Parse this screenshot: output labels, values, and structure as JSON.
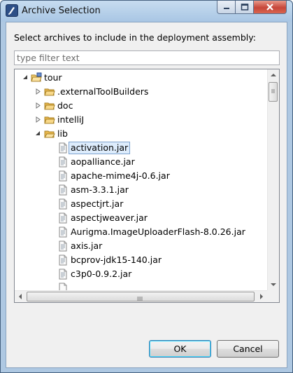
{
  "window": {
    "title": "Archive Selection"
  },
  "dialog": {
    "instruction": "Select archives to include in the deployment assembly:",
    "filter_placeholder": "type filter text",
    "filter_value": ""
  },
  "tree": {
    "items": [
      {
        "label": "tour",
        "type": "project",
        "expanded": true,
        "level": 0
      },
      {
        "label": ".externalToolBuilders",
        "type": "folder",
        "expanded": false,
        "level": 1
      },
      {
        "label": "doc",
        "type": "folder",
        "expanded": false,
        "level": 1
      },
      {
        "label": "intelliJ",
        "type": "folder",
        "expanded": false,
        "level": 1
      },
      {
        "label": "lib",
        "type": "folder",
        "expanded": true,
        "level": 1
      },
      {
        "label": "activation.jar",
        "type": "jar",
        "level": 2,
        "selected": true
      },
      {
        "label": "aopalliance.jar",
        "type": "jar",
        "level": 2
      },
      {
        "label": "apache-mime4j-0.6.jar",
        "type": "jar",
        "level": 2
      },
      {
        "label": "asm-3.3.1.jar",
        "type": "jar",
        "level": 2
      },
      {
        "label": "aspectjrt.jar",
        "type": "jar",
        "level": 2
      },
      {
        "label": "aspectjweaver.jar",
        "type": "jar",
        "level": 2
      },
      {
        "label": "Aurigma.ImageUploaderFlash-8.0.26.jar",
        "type": "jar",
        "level": 2
      },
      {
        "label": "axis.jar",
        "type": "jar",
        "level": 2
      },
      {
        "label": "bcprov-jdk15-140.jar",
        "type": "jar",
        "level": 2
      },
      {
        "label": "c3p0-0.9.2.jar",
        "type": "jar",
        "level": 2
      }
    ]
  },
  "buttons": {
    "ok": "OK",
    "cancel": "Cancel"
  },
  "colors": {
    "selection_bg": "#ddecfc",
    "selection_border": "#7da2ce",
    "folder": "#e8b64c",
    "titlebar": "#b9d1ea",
    "close_button": "#c6463a"
  }
}
